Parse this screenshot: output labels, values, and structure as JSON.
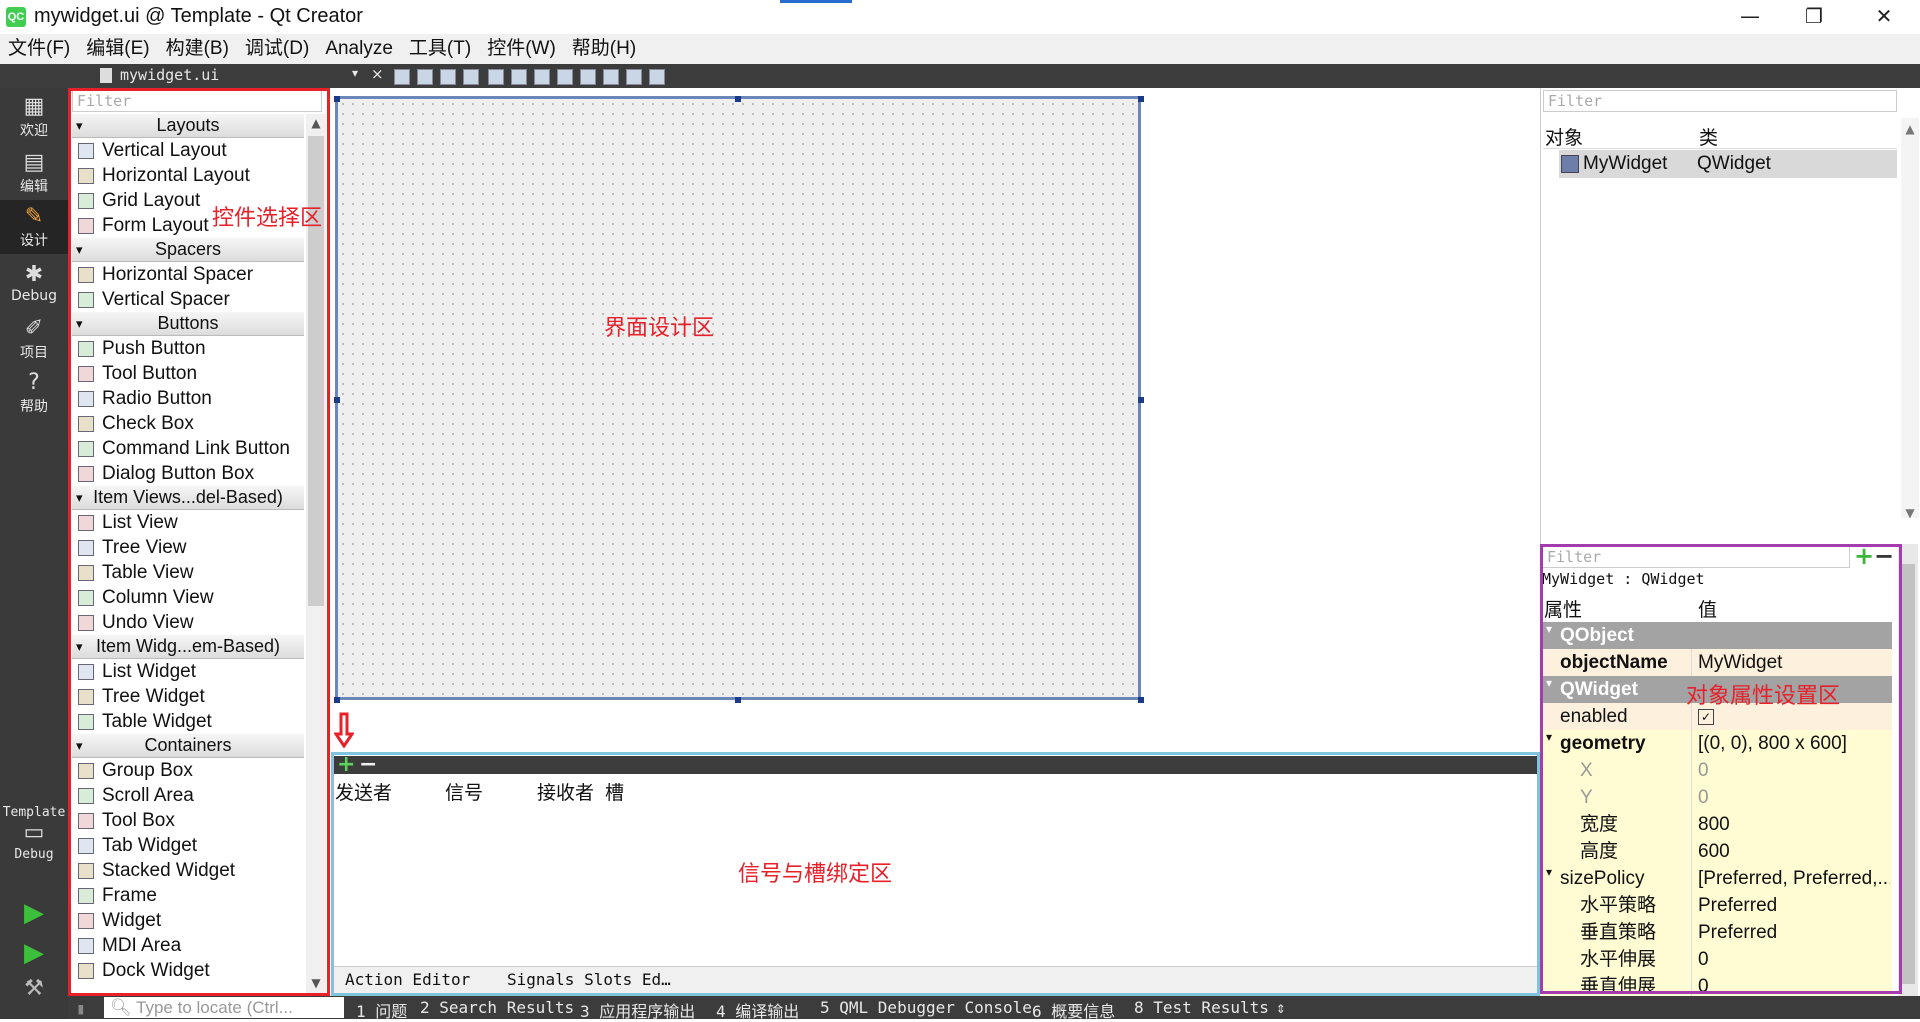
{
  "window": {
    "title": "mywidget.ui @ Template - Qt Creator",
    "app_icon_text": "QC",
    "controls": {
      "minimize": "—",
      "restore": "❐",
      "close": "✕"
    }
  },
  "menu": [
    "文件(F)",
    "编辑(E)",
    "构建(B)",
    "调试(D)",
    "Analyze",
    "工具(T)",
    "控件(W)",
    "帮助(H)"
  ],
  "editor_tab": {
    "file": "mywidget.ui",
    "dropdown": "▾",
    "close": "×"
  },
  "modes": [
    {
      "label": "欢迎",
      "icon": "grid-icon",
      "glyph": "▦"
    },
    {
      "label": "编辑",
      "icon": "document-icon",
      "glyph": "▤"
    },
    {
      "label": "设计",
      "icon": "pencil-icon",
      "glyph": "✎"
    },
    {
      "label": "Debug",
      "icon": "bug-icon",
      "glyph": "✱"
    },
    {
      "label": "项目",
      "icon": "wrench-icon",
      "glyph": "✐"
    },
    {
      "label": "帮助",
      "icon": "help-icon",
      "glyph": "?"
    }
  ],
  "kit": {
    "project": "Template",
    "config": "Debug"
  },
  "widget_box": {
    "filter_placeholder": "Filter",
    "categories": [
      {
        "name": "Layouts",
        "items": [
          "Vertical Layout",
          "Horizontal Layout",
          "Grid Layout",
          "Form Layout"
        ]
      },
      {
        "name": "Spacers",
        "items": [
          "Horizontal Spacer",
          "Vertical Spacer"
        ]
      },
      {
        "name": "Buttons",
        "items": [
          "Push Button",
          "Tool Button",
          "Radio Button",
          "Check Box",
          "Command Link Button",
          "Dialog Button Box"
        ]
      },
      {
        "name": "Item Views...del-Based)",
        "items": [
          "List View",
          "Tree View",
          "Table View",
          "Column View",
          "Undo View"
        ]
      },
      {
        "name": "Item Widg...em-Based)",
        "items": [
          "List Widget",
          "Tree Widget",
          "Table Widget"
        ]
      },
      {
        "name": "Containers",
        "items": [
          "Group Box",
          "Scroll Area",
          "Tool Box",
          "Tab Widget",
          "Stacked Widget",
          "Frame",
          "Widget",
          "MDI Area",
          "Dock Widget"
        ]
      }
    ]
  },
  "annotations": {
    "widget_area": "控件选择区",
    "design_area": "界面设计区",
    "signal_area": "信号与槽绑定区",
    "property_area": "对象属性设置区"
  },
  "signal_slot": {
    "columns": [
      "发送者",
      "信号",
      "接收者",
      "槽"
    ],
    "tabs": [
      "Action Editor",
      "Signals Slots Ed…"
    ]
  },
  "object_inspector": {
    "filter_placeholder": "Filter",
    "columns": [
      "对象",
      "类"
    ],
    "rows": [
      {
        "object": "MyWidget",
        "class": "QWidget"
      }
    ]
  },
  "property_editor": {
    "filter_placeholder": "Filter",
    "class_line": "MyWidget : QWidget",
    "columns": [
      "属性",
      "值"
    ],
    "rows": [
      {
        "name": "QObject",
        "value": "",
        "type": "group"
      },
      {
        "name": "objectName",
        "value": "MyWidget",
        "type": "bold"
      },
      {
        "name": "QWidget",
        "value": "",
        "type": "group"
      },
      {
        "name": "enabled",
        "value": "✓",
        "type": "check"
      },
      {
        "name": "geometry",
        "value": "[(0, 0), 800 x 600]",
        "type": "boldexp"
      },
      {
        "name": "X",
        "value": "0",
        "type": "subdis"
      },
      {
        "name": "Y",
        "value": "0",
        "type": "subdis"
      },
      {
        "name": "宽度",
        "value": "800",
        "type": "sub"
      },
      {
        "name": "高度",
        "value": "600",
        "type": "sub"
      },
      {
        "name": "sizePolicy",
        "value": "[Preferred, Preferred,...",
        "type": "exp"
      },
      {
        "name": "水平策略",
        "value": "Preferred",
        "type": "sub"
      },
      {
        "name": "垂直策略",
        "value": "Preferred",
        "type": "sub"
      },
      {
        "name": "水平伸展",
        "value": "0",
        "type": "sub"
      },
      {
        "name": "垂直伸展",
        "value": "0",
        "type": "sub"
      }
    ]
  },
  "status_bar": {
    "locate_placeholder": "Type to locate (Ctrl...",
    "panes": [
      "1 问题",
      "2 Search Results",
      "3 应用程序输出",
      "4 编译输出",
      "5 QML Debugger Console",
      "6 概要信息",
      "8 Test Results"
    ],
    "more": "⇕"
  },
  "colors": {
    "annotation_red": "#e8202a",
    "annotation_cyan": "#7ec4dc",
    "annotation_purple": "#a43cb0",
    "form_border": "#6a87b8"
  }
}
